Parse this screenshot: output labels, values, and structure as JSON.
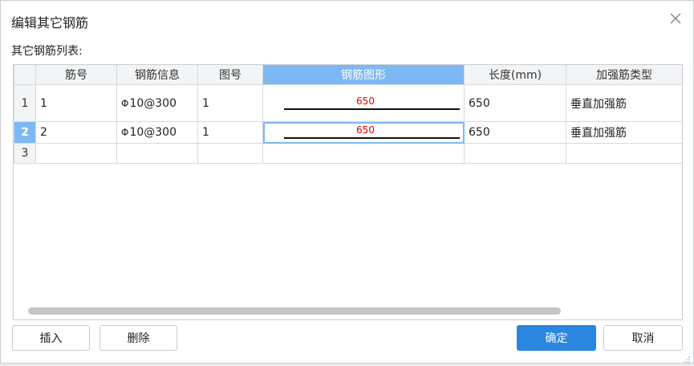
{
  "dialog": {
    "title": "编辑其它钢筋",
    "section_label": "其它钢筋列表:"
  },
  "table": {
    "columns": [
      "筋号",
      "钢筋信息",
      "图号",
      "钢筋图形",
      "长度(mm)",
      "加强筋类型"
    ],
    "selected_column_index": 3,
    "rows": [
      {
        "num": "1",
        "bar_no": "1",
        "rebar_symbol": "Φ",
        "rebar_info": "10@300",
        "fig_no": "1",
        "shape_dim": "650",
        "length": "650",
        "type": "垂直加强筋"
      },
      {
        "num": "2",
        "bar_no": "2",
        "rebar_symbol": "Φ",
        "rebar_info": "10@300",
        "fig_no": "1",
        "shape_dim": "650",
        "length": "650",
        "type": "垂直加强筋"
      },
      {
        "num": "3",
        "bar_no": "",
        "rebar_symbol": "",
        "rebar_info": "",
        "fig_no": "",
        "shape_dim": "",
        "length": "",
        "type": ""
      }
    ],
    "selected_row_index": 1
  },
  "buttons": {
    "insert": "插入",
    "delete": "删除",
    "ok": "确定",
    "cancel": "取消"
  },
  "colors": {
    "accent": "#2b86e0",
    "selection": "#7db8f5",
    "dimension_text": "#e60000"
  },
  "icons": {
    "close": "close-icon",
    "resize": "resize-grip-icon"
  }
}
